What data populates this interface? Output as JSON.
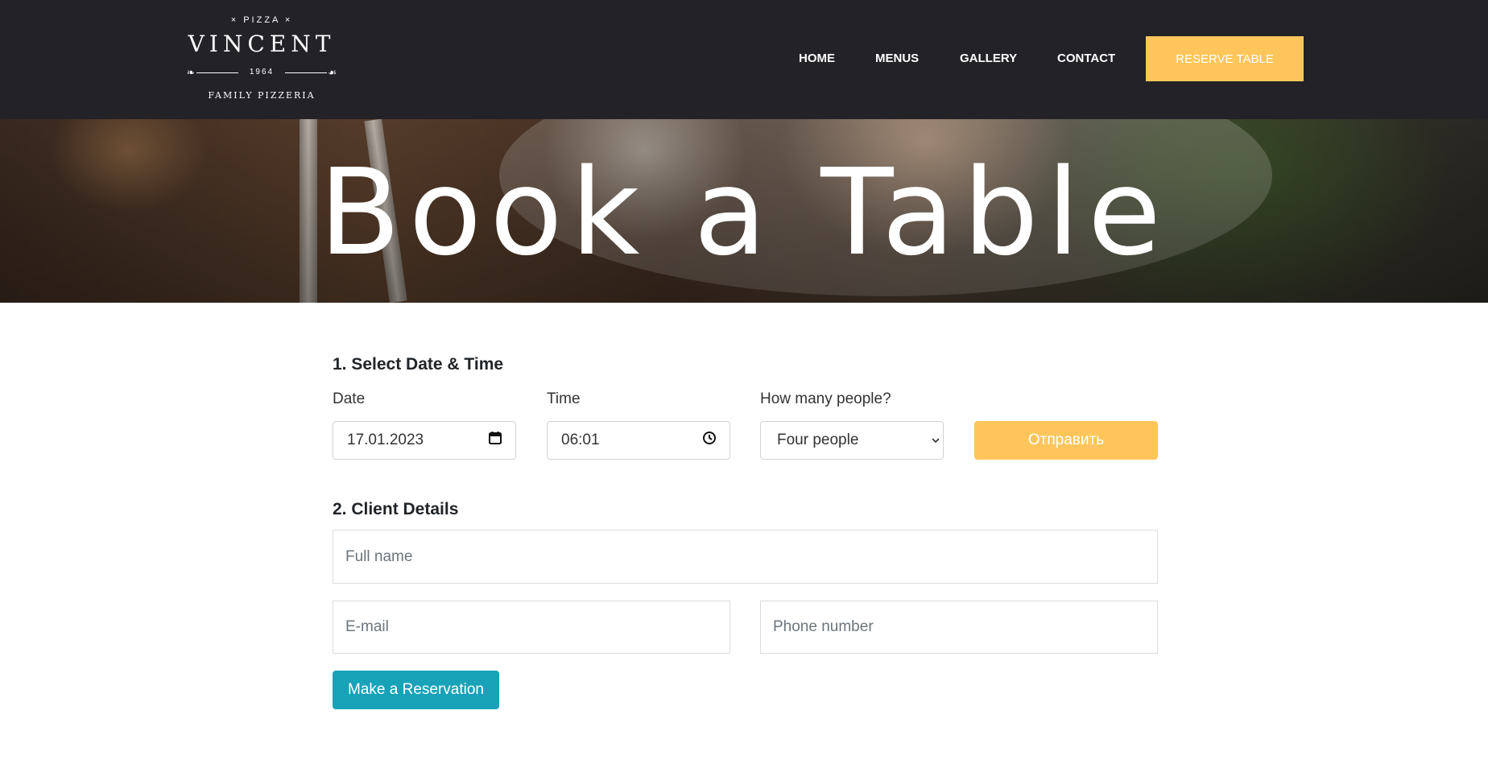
{
  "logo": {
    "top": "× PIZZA ×",
    "name": "VINCENT",
    "year": "1964",
    "subtitle": "FAMILY PIZZERIA"
  },
  "nav": {
    "items": [
      {
        "label": "HOME"
      },
      {
        "label": "MENUS"
      },
      {
        "label": "GALLERY"
      },
      {
        "label": "CONTACT"
      }
    ],
    "reserve_label": "RESERVE TABLE"
  },
  "hero": {
    "title": "Book a Table"
  },
  "form": {
    "section1_title": "1. Select Date & Time",
    "date_label": "Date",
    "date_value": "17.01.2023",
    "time_label": "Time",
    "time_value": "06:01",
    "people_label": "How many people?",
    "people_value": "Four people",
    "send_label": "Отправить",
    "section2_title": "2. Client Details",
    "fullname_placeholder": "Full name",
    "email_placeholder": "E-mail",
    "phone_placeholder": "Phone number",
    "submit_label": "Make a Reservation"
  },
  "colors": {
    "header_bg": "#232227",
    "accent_yellow": "#fec65a",
    "accent_teal": "#17a2b8"
  },
  "icons": {
    "date": "calendar-icon",
    "time": "clock-icon",
    "select": "chevron-down-icon"
  }
}
